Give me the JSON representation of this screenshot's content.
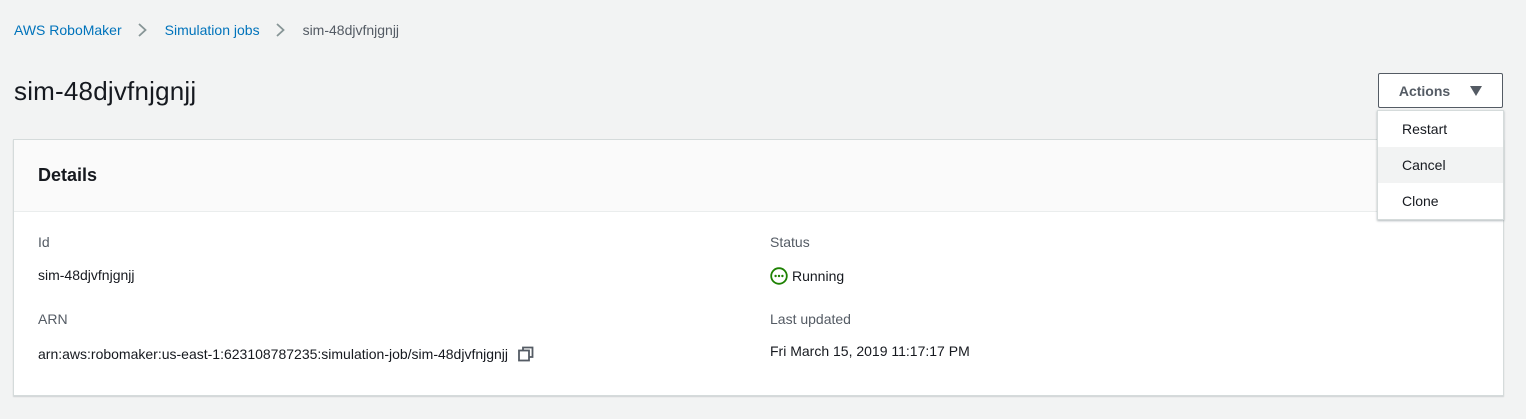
{
  "breadcrumb": {
    "items": [
      {
        "label": "AWS RoboMaker"
      },
      {
        "label": "Simulation jobs"
      }
    ],
    "current": "sim-48djvfnjgnjj"
  },
  "page": {
    "title": "sim-48djvfnjgnjj"
  },
  "actions": {
    "label": "Actions",
    "menu": [
      {
        "label": "Restart"
      },
      {
        "label": "Cancel"
      },
      {
        "label": "Clone"
      }
    ]
  },
  "details": {
    "heading": "Details",
    "id_label": "Id",
    "id_value": "sim-48djvfnjgnjj",
    "arn_label": "ARN",
    "arn_value": "arn:aws:robomaker:us-east-1:623108787235:simulation-job/sim-48djvfnjgnjj",
    "status_label": "Status",
    "status_value": "Running",
    "status_icon": "ellipsis-circle-icon",
    "last_updated_label": "Last updated",
    "last_updated_value": "Fri March 15, 2019 11:17:17 PM"
  },
  "colors": {
    "link": "#0073bb",
    "running": "#1d8102",
    "background": "#f2f3f3"
  }
}
